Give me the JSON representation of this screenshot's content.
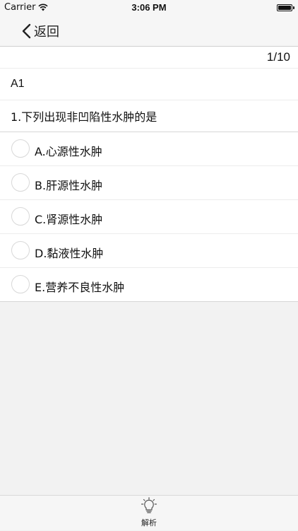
{
  "status_bar": {
    "carrier": "Carrier",
    "time": "3:06 PM",
    "battery_level": 1.0
  },
  "nav": {
    "back_label": "返回"
  },
  "quiz": {
    "counter": "1/10",
    "section": "A1",
    "question": "1.下列出现非凹陷性水肿的是",
    "options": [
      {
        "label": "A.心源性水肿",
        "selected": false
      },
      {
        "label": "B.肝源性水肿",
        "selected": false
      },
      {
        "label": "C.肾源性水肿",
        "selected": false
      },
      {
        "label": "D.黏液性水肿",
        "selected": false
      },
      {
        "label": "E.营养不良性水肿",
        "selected": false
      }
    ]
  },
  "tab_bar": {
    "analysis_label": "解析",
    "analysis_icon": "lightbulb-icon"
  }
}
